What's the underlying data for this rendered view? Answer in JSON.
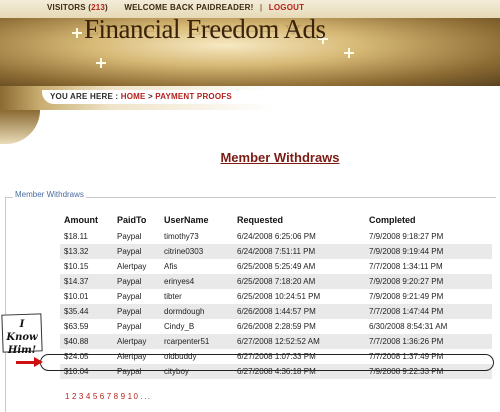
{
  "topbar": {
    "visitors_label": "VISITORS (",
    "visitors_count": "213",
    "visitors_close": ")",
    "welcome": "WELCOME BACK PAIDREADER!",
    "separator": "|",
    "logout": "LOGOUT"
  },
  "header": {
    "site_title": "Financial Freedom Ads"
  },
  "breadcrumb": {
    "prefix": "YOU ARE HERE :",
    "home": "HOME",
    "arrow": ">",
    "current": "PAYMENT PROOFS"
  },
  "page_title": "Member Withdraws",
  "fieldset_legend": "Member Withdraws",
  "table": {
    "headers": [
      "Amount",
      "PaidTo",
      "UserName",
      "Requested",
      "Completed"
    ],
    "rows": [
      [
        "$18.11",
        "Paypal",
        "timothy73",
        "6/24/2008 6:25:06 PM",
        "7/9/2008 9:18:27 PM"
      ],
      [
        "$13.32",
        "Paypal",
        "citrine0303",
        "6/24/2008 7:51:11 PM",
        "7/9/2008 9:19:44 PM"
      ],
      [
        "$10.15",
        "Alertpay",
        "Afis",
        "6/25/2008 5:25:49 AM",
        "7/7/2008 1:34:11 PM"
      ],
      [
        "$14.37",
        "Paypal",
        "erinyes4",
        "6/25/2008 7:18:20 AM",
        "7/9/2008 9:20:27 PM"
      ],
      [
        "$10.01",
        "Paypal",
        "tibter",
        "6/25/2008 10:24:51 PM",
        "7/9/2008 9:21:49 PM"
      ],
      [
        "$35.44",
        "Paypal",
        "dormdough",
        "6/26/2008 1:44:57 PM",
        "7/7/2008 1:47:44 PM"
      ],
      [
        "$63.59",
        "Paypal",
        "Cindy_B",
        "6/26/2008 2:28:59 PM",
        "6/30/2008 8:54:31 AM"
      ],
      [
        "$40.88",
        "Alertpay",
        "rcarpenter51",
        "6/27/2008 12:52:52 AM",
        "7/7/2008 1:36:26 PM"
      ],
      [
        "$24.05",
        "Alertpay",
        "oldbuddy",
        "6/27/2008 1:07:33 PM",
        "7/7/2008 1:37:49 PM"
      ],
      [
        "$10.04",
        "Paypal",
        "cityboy",
        "6/27/2008 4:36:18 PM",
        "7/9/2008 9:22:33 PM"
      ]
    ]
  },
  "annotation": {
    "line1": "I Know",
    "line2": "Him!"
  },
  "pagination": {
    "pages": [
      "1",
      "2",
      "3",
      "4",
      "5",
      "6",
      "7",
      "8",
      "9",
      "10",
      "..."
    ]
  },
  "colors": {
    "link_red": "#b4221c",
    "title_maroon": "#7a1c14",
    "gold": "#d7b976",
    "row_alt": "#e9e9e9",
    "arrow_red": "#d01010"
  }
}
